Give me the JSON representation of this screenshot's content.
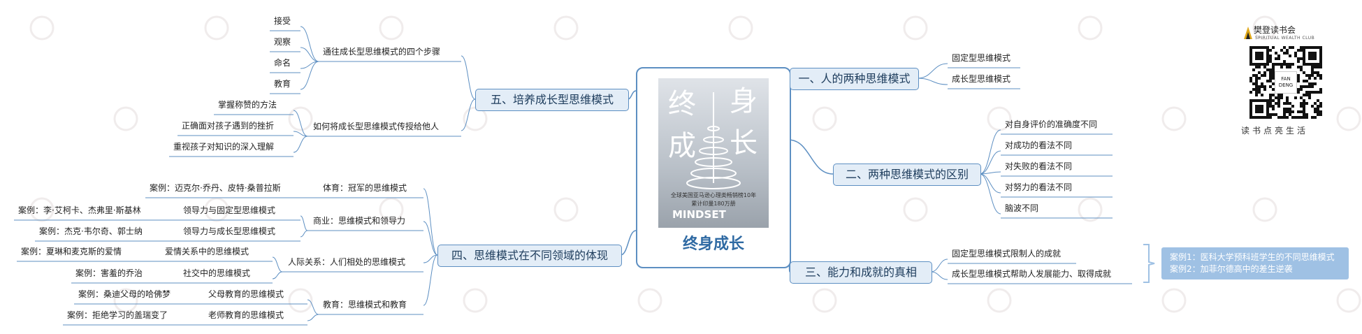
{
  "center": {
    "title": "终身成长",
    "cover_big": [
      "终",
      "身",
      "成",
      "长"
    ],
    "cover_en": "MINDSET",
    "cover_line1": "全球美国亚马逊心理类畅销榜10年",
    "cover_line2": "累计印量180万册"
  },
  "branches": {
    "b1": {
      "label": "一、人的两种思维模式",
      "children": [
        "固定型思维模式",
        "成长型思维模式"
      ]
    },
    "b2": {
      "label": "二、两种思维模式的区别",
      "children": [
        "对自身评价的准确度不同",
        "对成功的看法不同",
        "对失败的看法不同",
        "对努力的看法不同",
        "脑波不同"
      ]
    },
    "b3": {
      "label": "三、能力和成就的真相",
      "children": [
        "固定型思维模式限制人的成就",
        "成长型思维模式帮助人发展能力、取得成就"
      ],
      "note": [
        "案例1：医科大学预科班学生的不同思维模式",
        "案例2：加菲尔德高中的差生逆袭"
      ]
    },
    "b4": {
      "label": "四、思维模式在不同领域的体现",
      "sub": [
        {
          "label": "体育：冠军的思维模式",
          "case": "案例：迈克尔·乔丹、皮特·桑普拉斯"
        },
        {
          "label": "商业：思维模式和领导力",
          "items": [
            {
              "label": "领导力与固定型思维模式",
              "case": "案例：李·艾柯卡、杰弗里·斯基林"
            },
            {
              "label": "领导力与成长型思维模式",
              "case": "案例：杰克·韦尔奇、郭士纳"
            }
          ]
        },
        {
          "label": "人际关系：人们相处的思维模式",
          "items": [
            {
              "label": "爱情关系中的思维模式",
              "case": "案例：夏琳和麦克斯的爱情"
            },
            {
              "label": "社交中的思维模式",
              "case": "案例：害羞的乔治"
            }
          ]
        },
        {
          "label": "教育：思维模式和教育",
          "items": [
            {
              "label": "父母教育的思维模式",
              "case": "案例：桑迪父母的哈佛梦"
            },
            {
              "label": "老师教育的思维模式",
              "case": "案例：拒绝学习的盖瑞变了"
            }
          ]
        }
      ]
    },
    "b5": {
      "label": "五、培养成长型思维模式",
      "sub": [
        {
          "label": "通往成长型思维模式的四个步骤",
          "items": [
            "接受",
            "观察",
            "命名",
            "教育"
          ]
        },
        {
          "label": "如何将成长型思维模式传授给他人",
          "items": [
            "掌握称赞的方法",
            "正确面对孩子遇到的挫折",
            "重视孩子对知识的深入理解"
          ]
        }
      ]
    }
  },
  "brand": {
    "name": "樊登读书会",
    "sub": "SPIRITUAL WEALTH CLUB",
    "qr_label": "FAN DENG",
    "slogan": "读书点亮生活"
  },
  "colors": {
    "line": "#5d8fc2",
    "main_fill": "#e3edf7",
    "note_fill": "#9fc1e4",
    "title": "#2f6aa3"
  }
}
